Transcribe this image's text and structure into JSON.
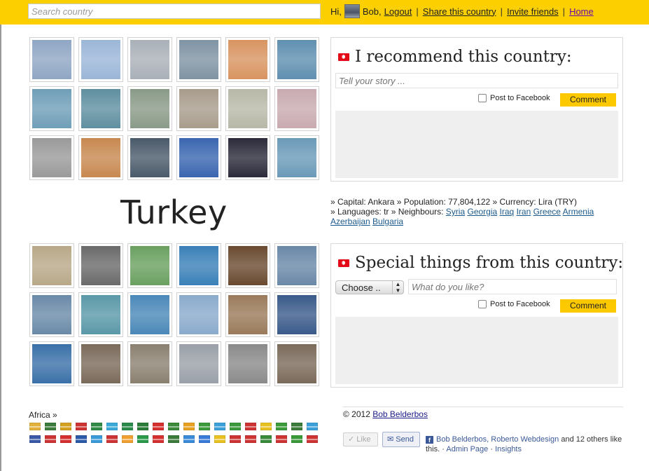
{
  "header": {
    "search_placeholder": "Search country",
    "greeting": "Hi,",
    "user_name": "Bob,",
    "logout": "Logout",
    "share": "Share this country",
    "invite": "Invite friends",
    "home": "Home",
    "separator": "|"
  },
  "recommend": {
    "title": "I recommend this country:",
    "story_placeholder": "Tell your story ...",
    "post_fb": "Post to Facebook",
    "comment": "Comment"
  },
  "country": {
    "name": "Turkey",
    "line1": "» Capital: Ankara » Population: 77,804,122 » Currency: Lira (TRY)",
    "line2_prefix": "» Languages: tr » Neighbours:",
    "neighbours": [
      "Syria",
      "Georgia",
      "Iraq",
      "Iran",
      "Greece",
      "Armenia",
      "Azerbaijan",
      "Bulgaria"
    ]
  },
  "special": {
    "title": "Special things from this country:",
    "choose": "Choose ..",
    "like_placeholder": "What do you like?",
    "post_fb": "Post to Facebook",
    "comment": "Comment"
  },
  "footer": {
    "africa": "Africa »",
    "copyright_prefix": "© 2012",
    "copyright_link": "Bob Belderbos",
    "like": "✓ Like",
    "send": "Send",
    "fb_names": "Bob Belderbos, Roberto Webdesign",
    "fb_others": "and 12 others like this.",
    "admin": "Admin Page",
    "insights": "Insights"
  },
  "colors": {
    "accent": "#fcd000",
    "comment_button": "#fcc800",
    "link": "#1c5a8c",
    "flag_red": "#e30a17"
  },
  "photos_top": [
    "#8fa6c4",
    "#9bb6d8",
    "#aab0b8",
    "#7f93a3",
    "#d89460",
    "#5f8fb0",
    "#6f9eb8",
    "#5f8fa0",
    "#8a9a88",
    "#a89c8c",
    "#b8b8a8",
    "#c8aab0",
    "#9a9a9a",
    "#c88850",
    "#4a5a6a",
    "#3a66b0",
    "#2a2a3a",
    "#6a9ab8"
  ],
  "photos_bottom": [
    "#b8a888",
    "#6a6a6a",
    "#6aa060",
    "#3a80b8",
    "#6a4a30",
    "#6a88a8",
    "#6a8aa8",
    "#5a98a8",
    "#4a88b8",
    "#8aaacc",
    "#9a7a5a",
    "#3a5a8a",
    "#3a70a8",
    "#7a6a5a",
    "#8a8070",
    "#9aa0a8",
    "#8a8a8a",
    "#7a6a5a"
  ],
  "flags_row1": [
    "#e2b13c",
    "#3a7a3a",
    "#d4a020",
    "#cc3333",
    "#2f8a46",
    "#3aa8d8",
    "#2a8a4a",
    "#2a7a3a",
    "#d43030",
    "#3a8a3a",
    "#e8a020",
    "#3a9a3a",
    "#3aa0d8",
    "#3a9a3a",
    "#cc3333",
    "#e8c020",
    "#3a9a3a",
    "#3a7a3a",
    "#3aa0d8"
  ],
  "flags_row2": [
    "#3a5aa8",
    "#cc3333",
    "#d43030",
    "#2a5aa8",
    "#3a9ad8",
    "#cc3333",
    "#f0a030",
    "#2a9a4a",
    "#d43030",
    "#3a7a3a",
    "#3a8ad8",
    "#3a7ad8",
    "#e8c020",
    "#cc3333",
    "#cc3333",
    "#3a8a3a",
    "#cc3333",
    "#3a9a3a",
    "#cc3333"
  ]
}
